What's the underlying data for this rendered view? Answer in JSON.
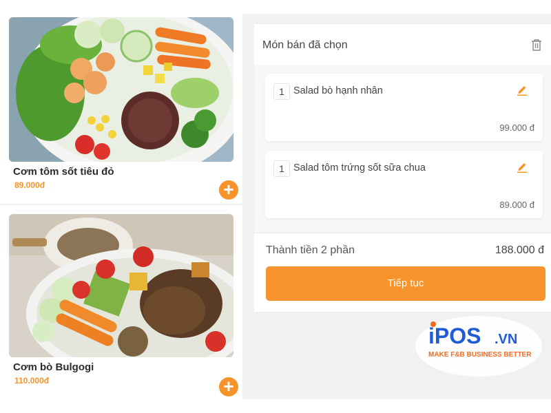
{
  "menu": {
    "items": [
      {
        "name": "Cơm tôm sốt tiêu đỏ",
        "price": "89.000đ"
      },
      {
        "name": "Cơm bò Bulgogi",
        "price": "110.000đ"
      }
    ],
    "add_icon": "plus-icon"
  },
  "order": {
    "title": "Món bán đã chọn",
    "items": [
      {
        "qty": "1",
        "name": "Salad bò hạnh nhân",
        "price": "99.000 đ"
      },
      {
        "qty": "1",
        "name": "Salad tôm trứng sốt sữa chua",
        "price": "89.000 đ"
      }
    ],
    "total_label": "Thành tiền 2 phần",
    "total_value": "188.000 đ",
    "continue_label": "Tiếp tục"
  },
  "brand": {
    "logo_text": "iPOS.VN",
    "tagline": "MAKE F&B BUSINESS BETTER"
  },
  "colors": {
    "accent": "#f6932a",
    "brand_blue": "#1f5bd6",
    "brand_orange": "#f26a21"
  }
}
